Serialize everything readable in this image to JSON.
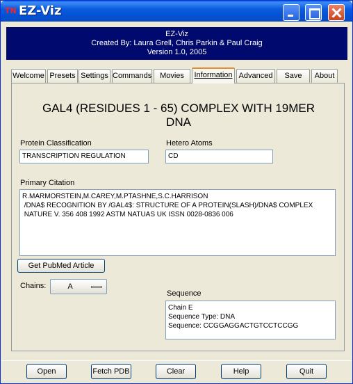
{
  "window": {
    "title": "EZ-Viz",
    "icon": "TN"
  },
  "banner": {
    "line1": "EZ-Viz",
    "line2": "Created By: Laura Grell, Chris Parkin & Paul Craig",
    "line3": "Version 1.0, 2005"
  },
  "tabs": [
    {
      "label": "Welcome"
    },
    {
      "label": "Presets"
    },
    {
      "label": "Settings"
    },
    {
      "label": "Commands"
    },
    {
      "label": "Movies"
    },
    {
      "label": "Information",
      "active": true
    },
    {
      "label": "Advanced"
    },
    {
      "label": "Save"
    },
    {
      "label": "About"
    }
  ],
  "info": {
    "title_line1": "GAL4 (RESIDUES 1 - 65) COMPLEX WITH 19MER",
    "title_line2": "DNA",
    "classification_label": "Protein Classification",
    "classification_value": "TRANSCRIPTION REGULATION",
    "hetero_label": "Hetero Atoms",
    "hetero_value": "CD",
    "citation_label": "Primary Citation",
    "citation_lines": [
      "R.MARMORSTEIN,M.CAREY,M.PTASHNE,S.C.HARRISON",
      " /DNA$ RECOGNITION BY /GAL4$: STRUCTURE OF A PROTEIN(SLASH)/DNA$ COMPLEX",
      " NATURE V. 356 408 1992 ASTM NATUAS UK ISSN 0028-0836 006"
    ],
    "pubmed_button": "Get PubMed Article",
    "chains_label": "Chains:",
    "chains_value": "A",
    "sequence_label": "Sequence",
    "sequence_lines": [
      "Chain E",
      "Sequence Type: DNA",
      "Sequence: CCGGAGGACTGTCCTCCGG"
    ]
  },
  "footer": {
    "open": "Open",
    "fetch": "Fetch PDB",
    "clear": "Clear",
    "help": "Help",
    "quit": "Quit"
  },
  "colors": {
    "titlebar": "#0451d4",
    "banner": "#000a6e",
    "window_bg": "#ece9d8",
    "active_tab_accent": "#e68b2c"
  }
}
